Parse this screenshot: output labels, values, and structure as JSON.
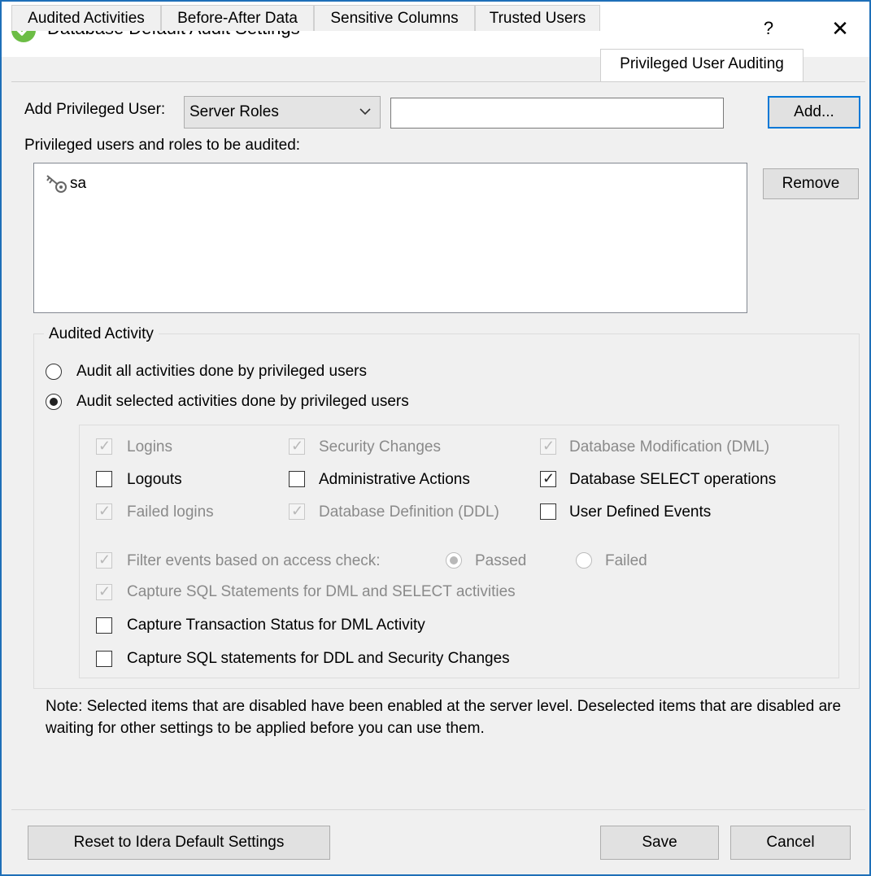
{
  "window": {
    "title": "Database Default Audit Settings",
    "help_label": "?",
    "close_label": "✕"
  },
  "tabs": [
    {
      "label": "Audited Activities",
      "active": false
    },
    {
      "label": "Before-After Data",
      "active": false
    },
    {
      "label": "Sensitive Columns",
      "active": false
    },
    {
      "label": "Trusted Users",
      "active": false
    },
    {
      "label": "Privileged User Auditing",
      "active": true
    }
  ],
  "privileged": {
    "add_label": "Add Privileged User:",
    "type_selected": "Server Roles",
    "user_value": "",
    "add_button": "Add...",
    "list_label": "Privileged users and roles to be audited:",
    "entries": [
      {
        "icon": "key-icon",
        "name": "sa"
      }
    ],
    "remove_button": "Remove"
  },
  "audited_activity": {
    "title": "Audited Activity",
    "radio_all": "Audit all activities done by privileged users",
    "radio_selected": "Audit selected activities done by privileged users",
    "selected_mode": "selected",
    "checks": {
      "logins": {
        "label": "Logins",
        "checked": true,
        "disabled": true
      },
      "security_changes": {
        "label": "Security Changes",
        "checked": true,
        "disabled": true
      },
      "dml": {
        "label": "Database Modification (DML)",
        "checked": true,
        "disabled": true
      },
      "logouts": {
        "label": "Logouts",
        "checked": false,
        "disabled": false
      },
      "admin_actions": {
        "label": "Administrative Actions",
        "checked": false,
        "disabled": false
      },
      "select_ops": {
        "label": "Database SELECT operations",
        "checked": true,
        "disabled": false
      },
      "failed_logins": {
        "label": "Failed logins",
        "checked": true,
        "disabled": true
      },
      "ddl": {
        "label": "Database Definition (DDL)",
        "checked": true,
        "disabled": true
      },
      "user_events": {
        "label": "User Defined Events",
        "checked": false,
        "disabled": false
      },
      "filter_access": {
        "label": "Filter events based on access check:",
        "checked": true,
        "disabled": true
      },
      "capture_sql_dml": {
        "label": "Capture SQL Statements for DML and SELECT activities",
        "checked": true,
        "disabled": true
      },
      "capture_tx_status": {
        "label": "Capture Transaction Status for DML Activity",
        "checked": false,
        "disabled": false
      },
      "capture_sql_ddl": {
        "label": "Capture SQL statements for DDL and Security Changes",
        "checked": false,
        "disabled": false
      }
    },
    "access_passed": "Passed",
    "access_failed": "Failed"
  },
  "note": "Note: Selected items that are disabled have been enabled at the server level. Deselected items that are disabled are waiting for other settings to be applied before you can use them.",
  "footer": {
    "reset_button": "Reset to Idera Default Settings",
    "save_button": "Save",
    "cancel_button": "Cancel"
  },
  "colors": {
    "accent": "#0078d7",
    "title_icon": "#6cbd45",
    "window_border": "#1e6fb8"
  }
}
